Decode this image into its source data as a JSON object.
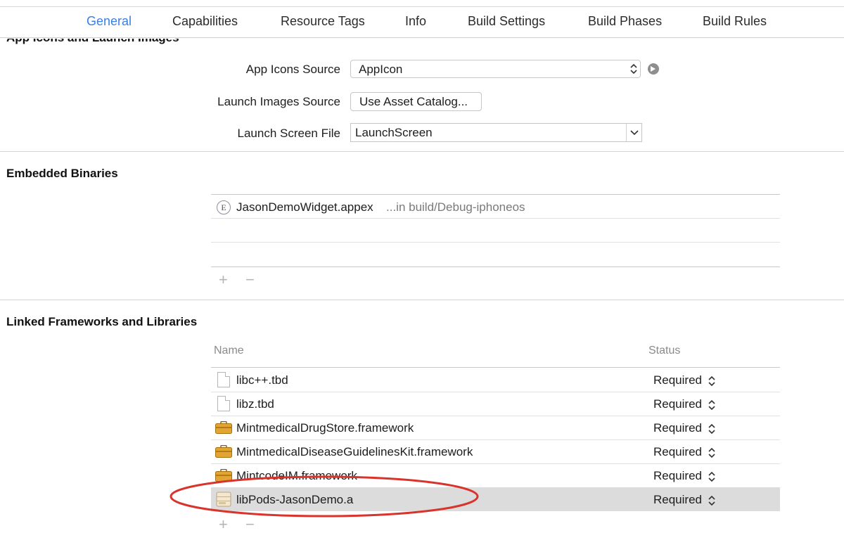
{
  "tabs": [
    {
      "label": "General",
      "active": true
    },
    {
      "label": "Capabilities",
      "active": false
    },
    {
      "label": "Resource Tags",
      "active": false
    },
    {
      "label": "Info",
      "active": false
    },
    {
      "label": "Build Settings",
      "active": false
    },
    {
      "label": "Build Phases",
      "active": false
    },
    {
      "label": "Build Rules",
      "active": false
    }
  ],
  "app_icons_section": {
    "clipped_title": "App Icons and Launch Images",
    "app_icons_source_label": "App Icons Source",
    "app_icons_source_value": "AppIcon",
    "launch_images_source_label": "Launch Images Source",
    "launch_images_source_button": "Use Asset Catalog...",
    "launch_screen_file_label": "Launch Screen File",
    "launch_screen_file_value": "LaunchScreen"
  },
  "embedded_binaries": {
    "title": "Embedded Binaries",
    "items": [
      {
        "badge": "E",
        "name": "JasonDemoWidget.appex",
        "location": "...in build/Debug-iphoneos"
      }
    ]
  },
  "linked_frameworks": {
    "title": "Linked Frameworks and Libraries",
    "columns": {
      "name": "Name",
      "status": "Status"
    },
    "rows": [
      {
        "icon": "file-icon",
        "name": "libc++.tbd",
        "status": "Required",
        "selected": false
      },
      {
        "icon": "file-icon",
        "name": "libz.tbd",
        "status": "Required",
        "selected": false
      },
      {
        "icon": "framework-toolbox-icon",
        "name": "MintmedicalDrugStore.framework",
        "status": "Required",
        "selected": false
      },
      {
        "icon": "framework-toolbox-icon",
        "name": "MintmedicalDiseaseGuidelinesKit.framework",
        "status": "Required",
        "selected": false
      },
      {
        "icon": "framework-toolbox-icon",
        "name": "MintcodeIM.framework",
        "status": "Required",
        "selected": false
      },
      {
        "icon": "static-library-icon",
        "name": "libPods-JasonDemo.a",
        "status": "Required",
        "selected": true
      }
    ]
  },
  "controls": {
    "add": "+",
    "remove": "−"
  },
  "colors": {
    "accent": "#3b7fe0",
    "highlight": "#d9342b",
    "selection": "#dcdcdc"
  }
}
